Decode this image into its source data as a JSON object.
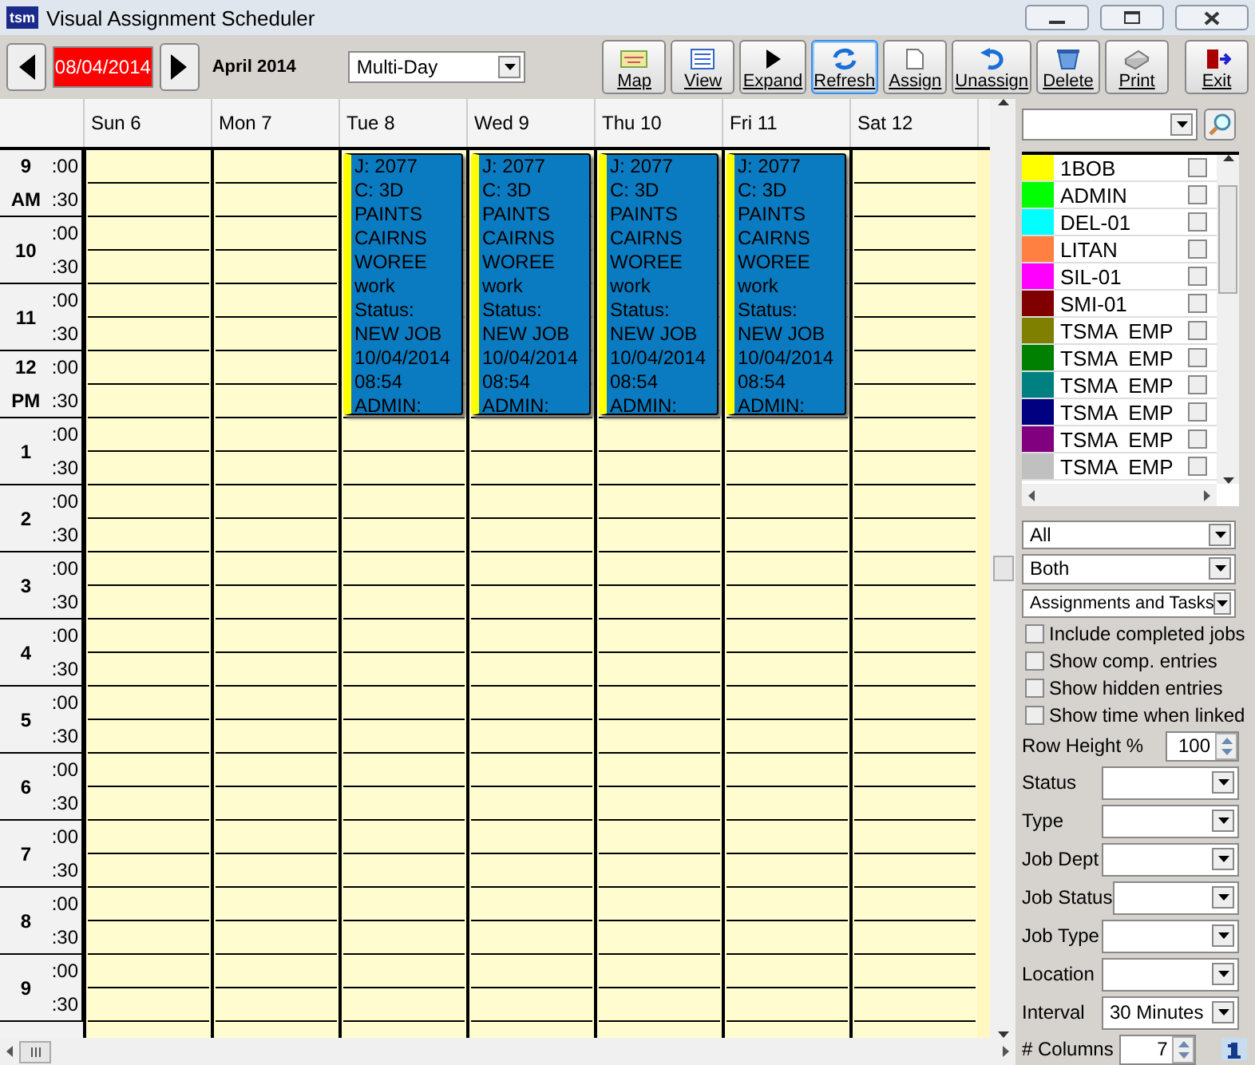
{
  "window": {
    "logo_text": "tsm",
    "title": "Visual Assignment Scheduler"
  },
  "navigation": {
    "date": "08/04/2014",
    "month": "April 2014",
    "view": "Multi-Day"
  },
  "toolbar": [
    {
      "kind": "map",
      "label": "Map",
      "selected": false
    },
    {
      "kind": "view",
      "label": "View",
      "selected": false
    },
    {
      "kind": "expand",
      "label": "Expand",
      "selected": false
    },
    {
      "kind": "refresh",
      "label": "Refresh",
      "selected": true
    },
    {
      "kind": "assign",
      "label": "Assign",
      "selected": false
    },
    {
      "kind": "unassign",
      "label": "Unassign",
      "selected": false
    },
    {
      "kind": "delete",
      "label": "Delete",
      "selected": false
    },
    {
      "kind": "print",
      "label": "Print",
      "selected": false
    },
    {
      "kind": "exit",
      "label": "Exit",
      "selected": false
    }
  ],
  "days": [
    {
      "label": "Sun 6"
    },
    {
      "label": "Mon 7"
    },
    {
      "label": "Tue 8",
      "appointments": [
        {
          "color": "#ffff00",
          "text": "J: 2077\nC: 3D\nPAINTS\nCAIRNS\nWOREE\nwork\nStatus:\nNEW JOB\n10/04/2014\n08:54\nADMIN:"
        }
      ]
    },
    {
      "label": "Wed 9",
      "appointments": [
        {
          "color": "#ffff00",
          "text": "J: 2077\nC: 3D\nPAINTS\nCAIRNS\nWOREE\nwork\nStatus:\nNEW JOB\n10/04/2014\n08:54\nADMIN:"
        }
      ]
    },
    {
      "label": "Thu 10",
      "appointments": [
        {
          "color": "#ffff00",
          "text": "J: 2077\nC: 3D\nPAINTS\nCAIRNS\nWOREE\nwork\nStatus:\nNEW JOB\n10/04/2014\n08:54\nADMIN:"
        }
      ]
    },
    {
      "label": "Fri 11",
      "appointments": [
        {
          "color": "#ffff00",
          "text": "J: 2077\nC: 3D\nPAINTS\nCAIRNS\nWOREE\nwork\nStatus:\nNEW JOB\n10/04/2014\n08:54\nADMIN:"
        }
      ]
    },
    {
      "label": "Sat 12"
    }
  ],
  "hours": [
    {
      "label": "9",
      "period": "AM",
      "slots": [
        ":00",
        ":30"
      ]
    },
    {
      "label": "10",
      "slots": [
        ":00",
        ":30"
      ]
    },
    {
      "label": "11",
      "slots": [
        ":00",
        ":30"
      ]
    },
    {
      "label": "12",
      "period": "PM",
      "slots": [
        ":00",
        ":30"
      ]
    },
    {
      "label": "1",
      "slots": [
        ":00",
        ":30"
      ]
    },
    {
      "label": "2",
      "slots": [
        ":00",
        ":30"
      ]
    },
    {
      "label": "3",
      "slots": [
        ":00",
        ":30"
      ]
    },
    {
      "label": "4",
      "slots": [
        ":00",
        ":30"
      ]
    },
    {
      "label": "5",
      "slots": [
        ":00",
        ":30"
      ]
    },
    {
      "label": "6",
      "slots": [
        ":00",
        ":30"
      ]
    },
    {
      "label": "7",
      "slots": [
        ":00",
        ":30"
      ]
    },
    {
      "label": "8",
      "slots": [
        ":00",
        ":30"
      ]
    },
    {
      "label": "9",
      "slots": [
        ":00",
        ":30"
      ]
    }
  ],
  "resources": [
    {
      "name": "1BOB",
      "color": "#ffff00",
      "checked": false
    },
    {
      "name": "ADMIN",
      "color": "#00ff00",
      "checked": false
    },
    {
      "name": "DEL-01",
      "color": "#00ffff",
      "checked": false
    },
    {
      "name": "LITAN",
      "color": "#ff8040",
      "checked": false
    },
    {
      "name": "SIL-01",
      "color": "#ff00ff",
      "checked": false
    },
    {
      "name": "SMI-01",
      "color": "#800000",
      "checked": false
    },
    {
      "name": "TSMA  EMP",
      "color": "#808000",
      "checked": false
    },
    {
      "name": "TSMA  EMP",
      "color": "#008000",
      "checked": false
    },
    {
      "name": "TSMA  EMP",
      "color": "#008080",
      "checked": false
    },
    {
      "name": "TSMA  EMP",
      "color": "#000080",
      "checked": false
    },
    {
      "name": "TSMA  EMP",
      "color": "#800080",
      "checked": false
    },
    {
      "name": "TSMA  EMP",
      "color": "#c0c0c0",
      "checked": false
    }
  ],
  "filter_dropdowns": [
    "All",
    "Both",
    "Assignments and Tasks"
  ],
  "options": [
    {
      "label": "Include completed jobs",
      "checked": false
    },
    {
      "label": "Show comp. entries",
      "checked": false
    },
    {
      "label": "Show hidden entries",
      "checked": false
    },
    {
      "label": "Show time when linked",
      "checked": false
    }
  ],
  "row_height": {
    "label": "Row Height %",
    "value": "100"
  },
  "fields": [
    {
      "label": "Status"
    },
    {
      "label": "Type"
    },
    {
      "label": "Job Dept"
    },
    {
      "label": "Job Status"
    },
    {
      "label": "Job Type"
    },
    {
      "label": "Location"
    },
    {
      "label": "Interval",
      "value": "30 Minutes"
    }
  ],
  "columns": {
    "label": "# Columns",
    "value": "7"
  }
}
